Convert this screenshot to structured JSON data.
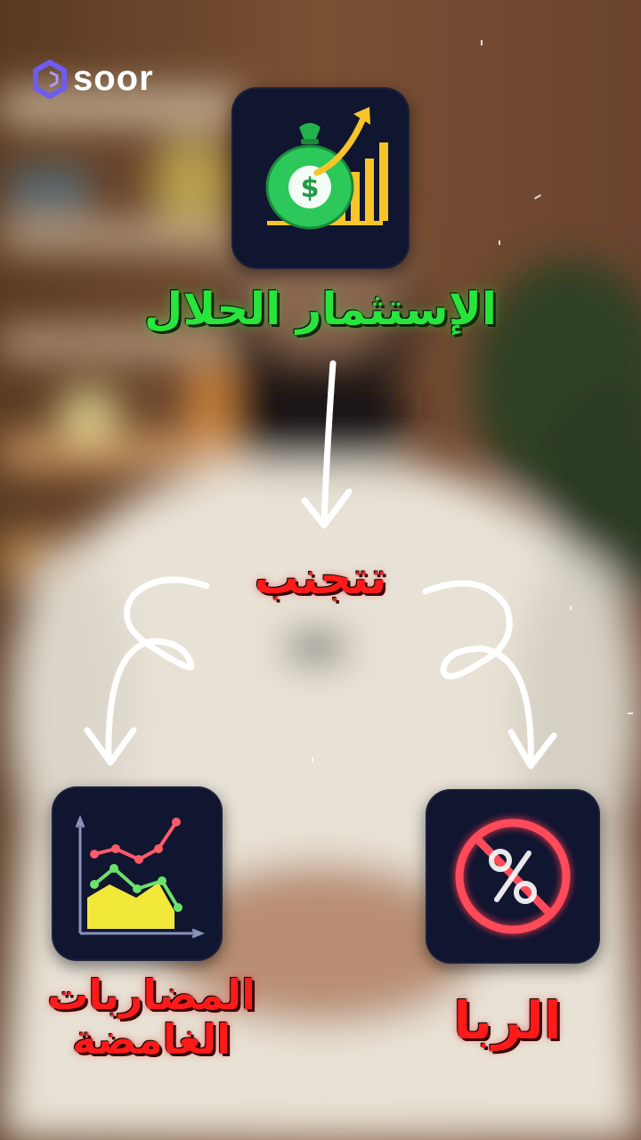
{
  "brand": {
    "name": "soor"
  },
  "top": {
    "title": "الإستثمار الحلال",
    "icon": "money-bag-growth-icon"
  },
  "middle": {
    "title": "تتجنب"
  },
  "left": {
    "line1": "المضاربات",
    "line2": "الغامضة",
    "icon": "volatile-chart-icon"
  },
  "right": {
    "title": "الربا",
    "icon": "no-interest-icon"
  },
  "colors": {
    "green": "#27e53c",
    "red": "#ff1a1a",
    "icon_bg": "#101530",
    "gold": "#f7c52a"
  }
}
